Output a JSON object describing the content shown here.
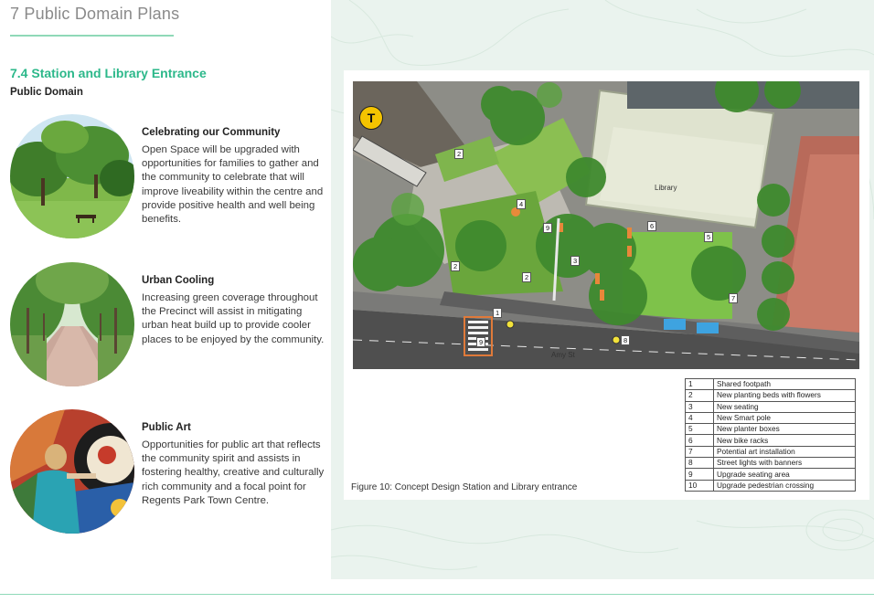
{
  "page": {
    "chapter": "7 Public Domain Plans",
    "section": "7.4 Station and Library Entrance",
    "subsection": "Public Domain"
  },
  "features": [
    {
      "title": "Celebrating our Community",
      "body": "Open Space will be upgraded with opportunities for families to gather and the community to celebrate that will improve liveability within the centre and provide positive health and well being benefits."
    },
    {
      "title": "Urban Cooling",
      "body": "Increasing green coverage throughout the Precinct will assist in mitigating urban heat build up to provide cooler places to be enjoyed by the community."
    },
    {
      "title": "Public Art",
      "body": "Opportunities for public art that reflects the community spirit and assists in fostering healthy, creative and culturally rich community and a focal point for Regents Park Town Centre."
    }
  ],
  "figure": {
    "caption": "Figure 10: Concept Design Station and Library entrance",
    "station_badge": "T",
    "library_label": "Library",
    "street_label": "Amy St",
    "markers": [
      "1",
      "2",
      "2",
      "2",
      "3",
      "4",
      "5",
      "6",
      "7",
      "8",
      "9",
      "9"
    ]
  },
  "legend": [
    {
      "num": "1",
      "label": "Shared footpath"
    },
    {
      "num": "2",
      "label": "New planting beds with flowers"
    },
    {
      "num": "3",
      "label": "New seating"
    },
    {
      "num": "4",
      "label": "New Smart pole"
    },
    {
      "num": "5",
      "label": "New planter boxes"
    },
    {
      "num": "6",
      "label": "New bike racks"
    },
    {
      "num": "7",
      "label": "Potential art installation"
    },
    {
      "num": "8",
      "label": "Street lights with banners"
    },
    {
      "num": "9",
      "label": "Upgrade seating area"
    },
    {
      "num": "10",
      "label": "Upgrade pedestrian crossing"
    }
  ],
  "colors": {
    "accent": "#2cb88a",
    "rule": "#8fd9b8",
    "panel_bg": "#eaf3ee"
  }
}
